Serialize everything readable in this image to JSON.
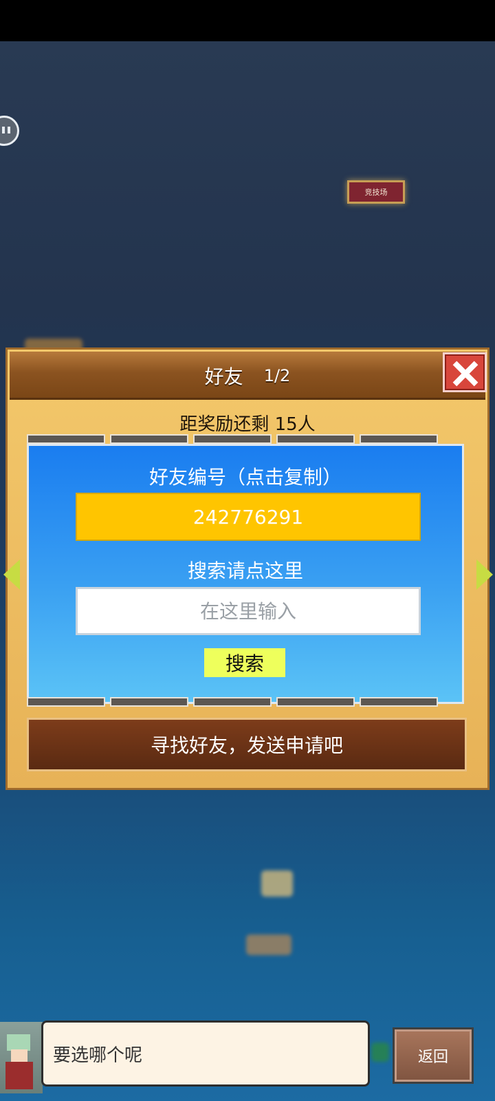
{
  "game_map": {
    "arena_tag": "竞技场"
  },
  "friend_panel": {
    "title": "好友",
    "page": "1/2",
    "remaining_text": "距奖励还剩 15人",
    "id_label": "好友编号（点击复制）",
    "friend_id": "242776291",
    "search_label": "搜索请点这里",
    "search_placeholder": "在这里输入",
    "search_button": "搜索",
    "cta_button": "寻找好友，发送申请吧"
  },
  "dialog": {
    "text": "要选哪个呢",
    "back_button": "返回"
  }
}
